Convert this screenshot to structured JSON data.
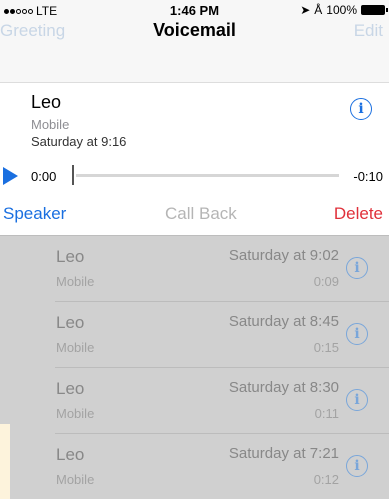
{
  "status_bar": {
    "carrier": "LTE",
    "time": "1:46 PM",
    "battery": "100%",
    "signal_bars_filled": 2,
    "signal_bars_total": 5
  },
  "nav": {
    "left": "Greeting",
    "title": "Voicemail",
    "right": "Edit"
  },
  "expanded": {
    "name": "Leo",
    "type": "Mobile",
    "date": "Saturday at 9:16",
    "time_elapsed": "0:00",
    "time_remaining": "-0:10",
    "progress": 0,
    "actions": {
      "speaker": "Speaker",
      "call_back": "Call Back",
      "delete": "Delete"
    }
  },
  "voicemails": [
    {
      "name": "Leo",
      "type": "Mobile",
      "date": "Saturday at 9:02",
      "duration": "0:09"
    },
    {
      "name": "Leo",
      "type": "Mobile",
      "date": "Saturday at 8:45",
      "duration": "0:15"
    },
    {
      "name": "Leo",
      "type": "Mobile",
      "date": "Saturday at 8:30",
      "duration": "0:11"
    },
    {
      "name": "Leo",
      "type": "Mobile",
      "date": "Saturday at 7:21",
      "duration": "0:12"
    }
  ],
  "colors": {
    "accent": "#1a6fe0",
    "delete": "#e0303a",
    "disabled": "#b5b5b5",
    "list_bg": "#d0d0d0"
  },
  "icons": {
    "info": "info-icon",
    "play": "play-icon",
    "location": "location-arrow-icon",
    "bluetooth": "bluetooth-icon"
  }
}
